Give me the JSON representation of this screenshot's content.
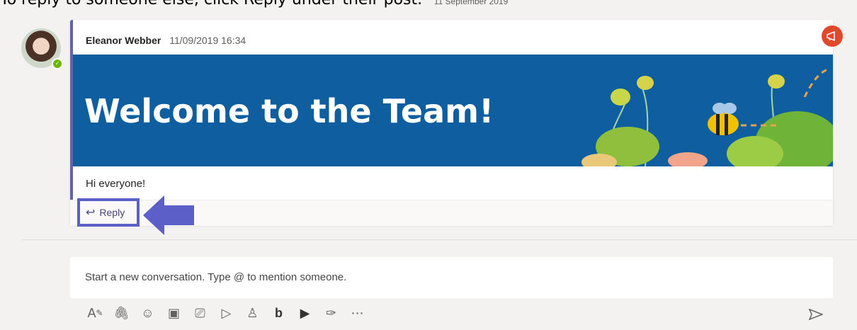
{
  "top_caption": "To reply to someone else, click Reply under their post.",
  "date_divider": "11 September 2019",
  "post": {
    "author": "Eleanor Webber",
    "timestamp": "11/09/2019 16:34",
    "banner_title": "Welcome to the Team!",
    "body": "Hi everyone!",
    "reply_label": "Reply"
  },
  "compose": {
    "placeholder": "Start a new conversation. Type @ to mention someone."
  },
  "toolbar_icons": [
    "format-icon",
    "attach-icon",
    "emoji-icon",
    "sticker-icon",
    "meet-now-icon",
    "stream-icon",
    "praise-icon",
    "bing-icon",
    "youtube-icon",
    "more-apps-icon",
    "more-options-icon"
  ],
  "colors": {
    "accent": "#6264a7",
    "banner": "#0f5fa0",
    "highlight": "#5b5fc7",
    "announcement": "#e04a2a",
    "presence": "#6bb700"
  }
}
